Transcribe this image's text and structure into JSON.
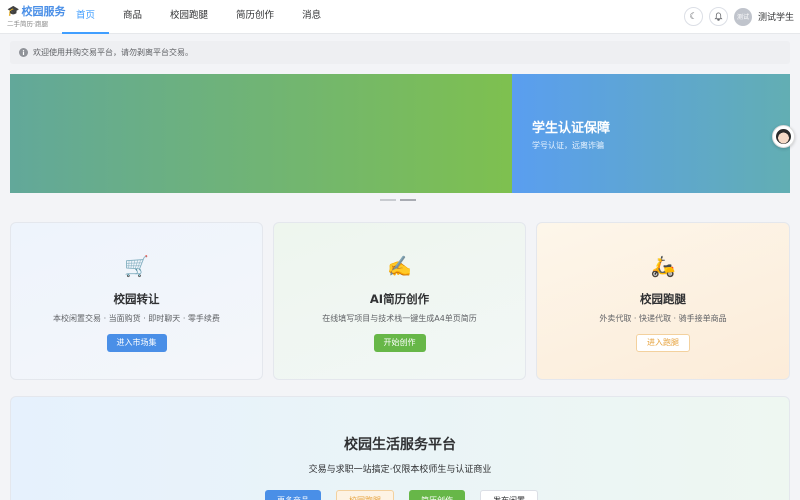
{
  "header": {
    "logo_title": "校园服务",
    "logo_subtitle": "二手简历·跑腿",
    "nav": [
      {
        "label": "首页",
        "active": true
      },
      {
        "label": "商品",
        "active": false
      },
      {
        "label": "校园跑腿",
        "active": false
      },
      {
        "label": "简历创作",
        "active": false
      },
      {
        "label": "消息",
        "active": false
      }
    ],
    "theme_icon": "☾",
    "bell_icon": "🔔",
    "avatar_text": "测试",
    "user_name": "测试学生"
  },
  "notice": {
    "icon": "i",
    "text": "欢迎使用并购交易平台，请勿剥离平台交易。"
  },
  "banner": {
    "slide_title": "学生认证保障",
    "slide_subtitle": "学号认证，远离诈骗"
  },
  "cards": [
    {
      "icon": "🛒",
      "title": "校园转让",
      "desc": "本校闲置交易 · 当面购货 · 即时聊天 · 零手续费",
      "button": "进入市场集",
      "color": "#4a8fe7"
    },
    {
      "icon": "✍️",
      "title": "AI简历创作",
      "desc": "在线填写项目与技术栈一键生成A4单页简历",
      "button": "开始创作",
      "color": "#67b748"
    },
    {
      "icon": "🛵",
      "title": "校园跑腿",
      "desc": "外卖代取 · 快递代取 · 骑手接单商品",
      "button": "进入跑腿",
      "color": "#e6a23c"
    }
  ],
  "platform": {
    "title": "校园生活服务平台",
    "subtitle": "交易与求职一站搞定·仅限本校师生与认证商业",
    "buttons": [
      "更多商品",
      "校园跑腿",
      "简历创作",
      "发布闲置"
    ]
  }
}
